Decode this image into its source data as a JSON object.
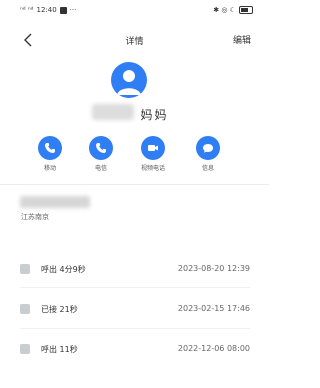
{
  "statusbar": {
    "signal_text": "ⁿᵈ ⁿᵈ",
    "time": "12:40",
    "extra": "···",
    "right_icons": "✱ ◎ ☾"
  },
  "header": {
    "title": "详情",
    "edit_label": "编辑"
  },
  "contact": {
    "name_visible": "妈妈",
    "location": "江苏南京"
  },
  "actions": [
    {
      "label": "移动",
      "icon": "phone-icon"
    },
    {
      "label": "电信",
      "icon": "phone-icon"
    },
    {
      "label": "视频电话",
      "icon": "video-icon"
    },
    {
      "label": "信息",
      "icon": "message-icon"
    }
  ],
  "calls": [
    {
      "type": "呼出 4分9秒",
      "time": "2023-08-20 12:39"
    },
    {
      "type": "已接 21秒",
      "time": "2023-02-15 17:46"
    },
    {
      "type": "呼出 11秒",
      "time": "2022-12-06 08:00"
    }
  ],
  "colors": {
    "accent": "#2f7ef4",
    "call_icon": "#c9cdd2"
  }
}
